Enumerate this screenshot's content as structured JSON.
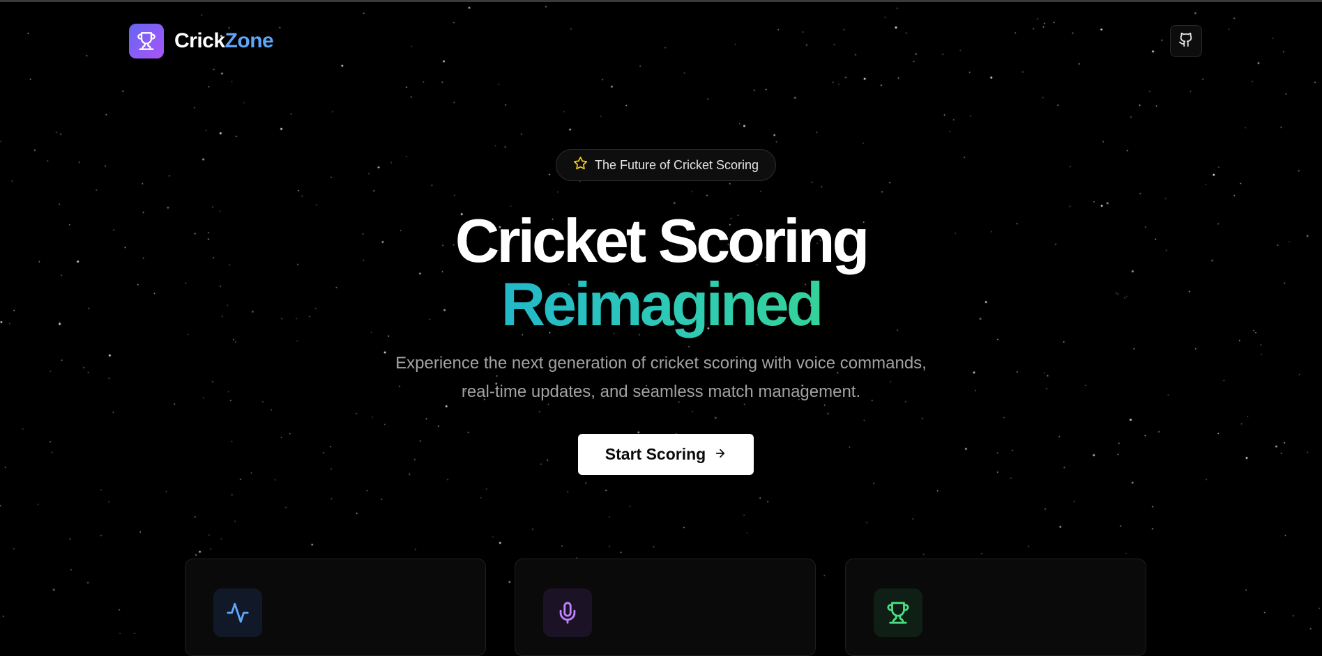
{
  "brand": {
    "name_part1": "Crick",
    "name_part2": "Zone",
    "logo_icon": "trophy-icon",
    "accent": "#60a5fa"
  },
  "header": {
    "github_icon": "github-icon"
  },
  "hero": {
    "pill_icon": "star-icon",
    "pill_text": "The Future of Cricket Scoring",
    "title_line1": "Cricket Scoring",
    "title_line2": "Reimagined",
    "description_line1": "Experience the next generation of cricket scoring with voice commands,",
    "description_line2": "real-time updates, and seamless match management.",
    "cta_label": "Start Scoring",
    "cta_icon": "arrow-right-icon"
  },
  "features": [
    {
      "icon": "activity-icon",
      "color": "#60a5fa"
    },
    {
      "icon": "microphone-icon",
      "color": "#c084fc"
    },
    {
      "icon": "trophy-icon",
      "color": "#4ade80"
    }
  ],
  "colors": {
    "background": "#000000",
    "gradient_start": "#22b8c9",
    "gradient_end": "#34d399",
    "logo_gradient": "#8b5cf6"
  }
}
